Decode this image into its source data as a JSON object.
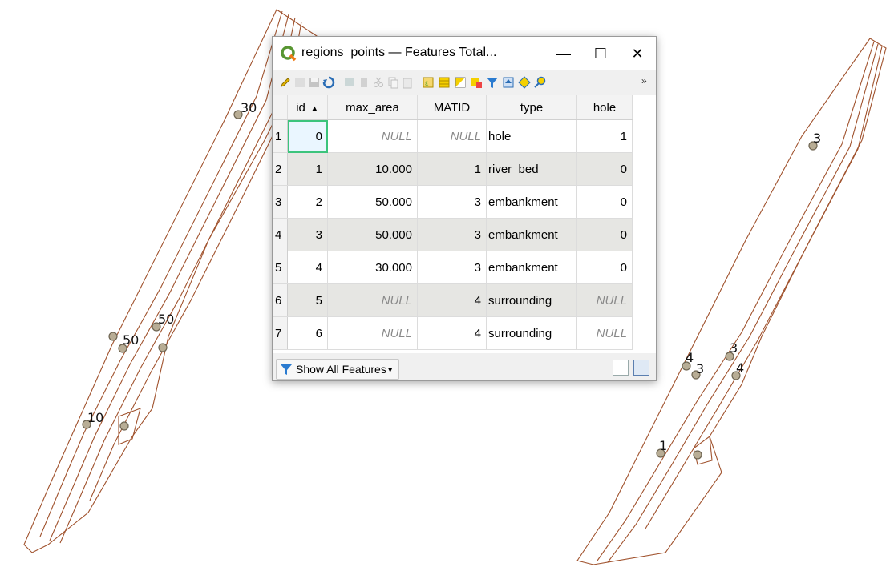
{
  "window": {
    "title": "regions_points — Features Total...",
    "min_glyph": "—",
    "max_glyph": "☐",
    "close_glyph": "✕",
    "app_icon": "qgis-icon"
  },
  "toolbar": {
    "more_glyph": "»",
    "icons": [
      "pencil-icon",
      "multi-edit-icon",
      "save-edits-icon",
      "reload-icon",
      "add-feature-icon",
      "delete-feature-icon",
      "cut-icon",
      "copy-icon",
      "paste-icon",
      "expression-select-icon",
      "select-all-icon",
      "invert-selection-icon",
      "deselect-icon",
      "filter-selected-icon",
      "move-selection-top-icon",
      "pan-to-selection-icon",
      "zoom-to-selection-icon"
    ]
  },
  "table": {
    "columns": [
      "id",
      "max_area",
      "MATID",
      "type",
      "hole"
    ],
    "sort_arrow": "▲",
    "rows": [
      {
        "n": "1",
        "id": "0",
        "max_area": "NULL",
        "matid": "NULL",
        "type": "hole",
        "hole": "1"
      },
      {
        "n": "2",
        "id": "1",
        "max_area": "10.000",
        "matid": "1",
        "type": "river_bed",
        "hole": "0"
      },
      {
        "n": "3",
        "id": "2",
        "max_area": "50.000",
        "matid": "3",
        "type": "embankment",
        "hole": "0"
      },
      {
        "n": "4",
        "id": "3",
        "max_area": "50.000",
        "matid": "3",
        "type": "embankment",
        "hole": "0"
      },
      {
        "n": "5",
        "id": "4",
        "max_area": "30.000",
        "matid": "3",
        "type": "embankment",
        "hole": "0"
      },
      {
        "n": "6",
        "id": "5",
        "max_area": "NULL",
        "matid": "4",
        "type": "surrounding",
        "hole": "NULL"
      },
      {
        "n": "7",
        "id": "6",
        "max_area": "NULL",
        "matid": "4",
        "type": "surrounding",
        "hole": "NULL"
      }
    ]
  },
  "statusbar": {
    "show_all_label": "Show All Features",
    "dropdown_glyph": "▾"
  },
  "map_left": {
    "labels": [
      "30",
      "50",
      "50",
      "10"
    ]
  },
  "map_right": {
    "labels": [
      "3",
      "4",
      "3",
      "3",
      "4",
      "1"
    ]
  },
  "colors": {
    "line": "#a0522d",
    "point_fill": "#b8ad95",
    "selection": "#3cc47c"
  }
}
